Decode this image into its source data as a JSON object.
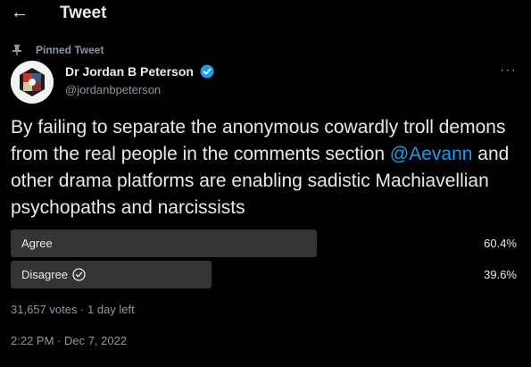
{
  "header": {
    "back_icon": "arrow-left-icon",
    "title": "Tweet"
  },
  "pinned": {
    "icon": "pin-icon",
    "label": "Pinned Tweet"
  },
  "author": {
    "name": "Dr Jordan B Peterson",
    "handle": "@jordanbpeterson",
    "verified_icon": "verified-badge-icon",
    "more_icon": "more-horizontal-icon"
  },
  "tweet": {
    "text_before": "By failing to separate the anonymous cowardly troll demons from the real people in the comments section ",
    "mention": "@Aevann",
    "text_after": " and other drama platforms are enabling sadistic Machiavellian psychopaths and narcissists"
  },
  "poll": {
    "options": [
      {
        "label": "Agree",
        "percent": "60.4%",
        "fraction": 0.604,
        "selected": false
      },
      {
        "label": "Disagree",
        "percent": "39.6%",
        "fraction": 0.396,
        "selected": true,
        "icon": "check-circle-icon"
      }
    ],
    "meta": "31,657 votes · 1 day left"
  },
  "timestamp": "2:22 PM · Dec 7, 2022",
  "colors": {
    "background": "#000000",
    "text": "#e7e9ea",
    "muted": "#8b98a5",
    "accent": "#1d9bf0",
    "poll_bar": "#333639"
  }
}
